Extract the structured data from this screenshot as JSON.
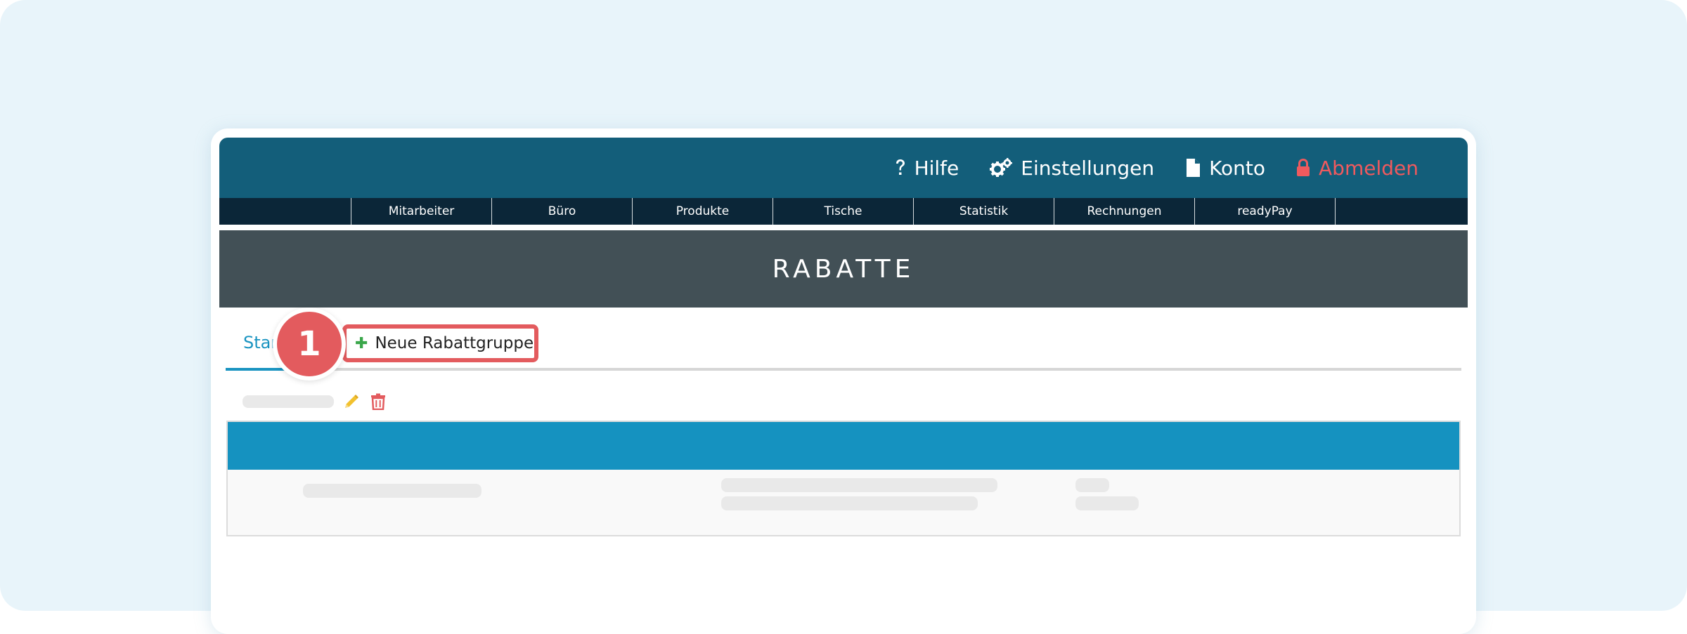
{
  "topbar": {
    "help_label": "Hilfe",
    "settings_label": "Einstellungen",
    "account_label": "Konto",
    "logout_label": "Abmelden"
  },
  "nav": {
    "items": [
      "Mitarbeiter",
      "Büro",
      "Produkte",
      "Tische",
      "Statistik",
      "Rechnungen",
      "readyPay"
    ]
  },
  "page": {
    "title": "RABATTE"
  },
  "tabs": {
    "start_label": "Start",
    "new_group_label": "Neue Rabattgruppe"
  },
  "annotation": {
    "step_number": "1"
  },
  "colors": {
    "topbar": "#135e7a",
    "navbar": "#0b2638",
    "title_bar": "#425056",
    "accent_blue": "#1a94c1",
    "highlight_red": "#e35b5e",
    "logout_red": "#f05a5e",
    "plus_green": "#3aa64a",
    "edit_yellow": "#f2c12e",
    "delete_red": "#e35b5e"
  },
  "icons": {
    "help": "question-mark-icon",
    "settings": "gears-icon",
    "account": "file-icon",
    "logout": "lock-icon",
    "add": "plus-icon",
    "edit": "pencil-icon",
    "delete": "trash-icon"
  }
}
